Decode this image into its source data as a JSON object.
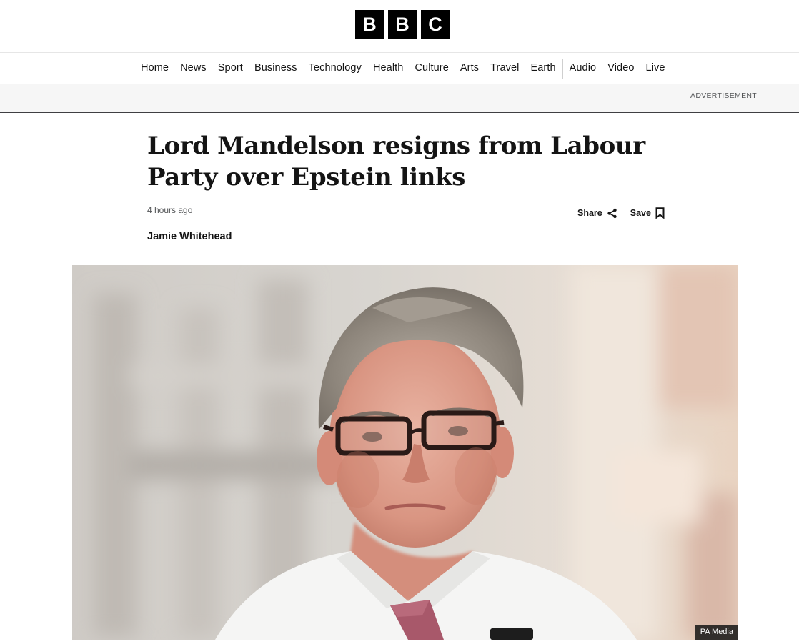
{
  "logo": {
    "letters": [
      "B",
      "B",
      "C"
    ]
  },
  "nav": {
    "items": [
      {
        "label": "Home"
      },
      {
        "label": "News"
      },
      {
        "label": "Sport"
      },
      {
        "label": "Business"
      },
      {
        "label": "Technology"
      },
      {
        "label": "Health"
      },
      {
        "label": "Culture"
      },
      {
        "label": "Arts"
      },
      {
        "label": "Travel"
      },
      {
        "label": "Earth"
      },
      {
        "label": "Audio"
      },
      {
        "label": "Video"
      },
      {
        "label": "Live"
      }
    ]
  },
  "ad": {
    "label": "ADVERTISEMENT"
  },
  "article": {
    "headline": "Lord Mandelson resigns from Labour Party over Epstein links",
    "timestamp": "4 hours ago",
    "byline": "Jamie Whitehead",
    "share_label": "Share",
    "save_label": "Save",
    "image_credit": "PA Media"
  },
  "colors": {
    "logo_bg": "#000000",
    "rule": "#3f3f42",
    "ad_bg": "#f6f6f6"
  }
}
